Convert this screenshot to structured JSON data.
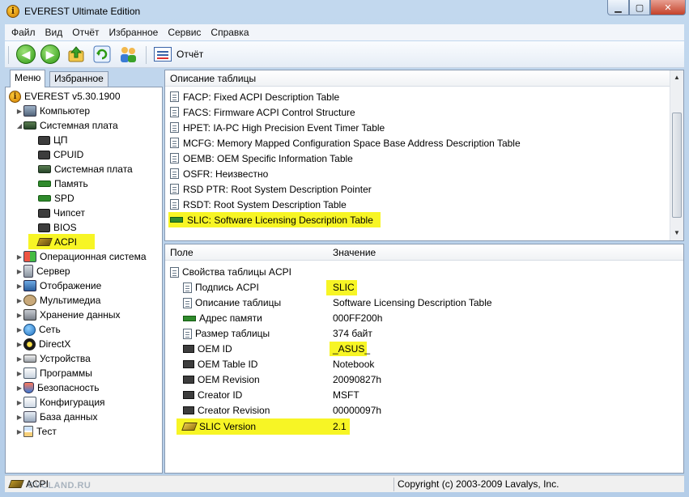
{
  "window": {
    "title": "EVEREST Ultimate Edition"
  },
  "menu": [
    "Файл",
    "Вид",
    "Отчёт",
    "Избранное",
    "Сервис",
    "Справка"
  ],
  "toolbar": {
    "report_label": "Отчёт"
  },
  "left_tabs": {
    "menu": "Меню",
    "favorites": "Избранное"
  },
  "tree": [
    {
      "label": "EVEREST v5.30.1900",
      "icon": "info-icon",
      "level": 0,
      "arrow": ""
    },
    {
      "label": "Компьютер",
      "icon": "computer-icon",
      "level": 1,
      "arrow": "▶"
    },
    {
      "label": "Системная плата",
      "icon": "motherboard-icon",
      "level": 1,
      "arrow": "◢"
    },
    {
      "label": "ЦП",
      "icon": "cpu-icon",
      "level": 2,
      "arrow": ""
    },
    {
      "label": "CPUID",
      "icon": "chip-icon",
      "level": 2,
      "arrow": ""
    },
    {
      "label": "Системная плата",
      "icon": "motherboard-icon",
      "level": 2,
      "arrow": ""
    },
    {
      "label": "Память",
      "icon": "memory-icon",
      "level": 2,
      "arrow": ""
    },
    {
      "label": "SPD",
      "icon": "memory-icon",
      "level": 2,
      "arrow": ""
    },
    {
      "label": "Чипсет",
      "icon": "chip-icon",
      "level": 2,
      "arrow": ""
    },
    {
      "label": "BIOS",
      "icon": "chip-icon",
      "level": 2,
      "arrow": ""
    },
    {
      "label": "ACPI",
      "icon": "acpi-icon",
      "level": 2,
      "arrow": "",
      "highlighted": true
    },
    {
      "label": "Операционная система",
      "icon": "windows-icon",
      "level": 1,
      "arrow": "▶"
    },
    {
      "label": "Сервер",
      "icon": "server-icon",
      "level": 1,
      "arrow": "▶"
    },
    {
      "label": "Отображение",
      "icon": "monitor-icon",
      "level": 1,
      "arrow": "▶"
    },
    {
      "label": "Мультимедиа",
      "icon": "multimedia-icon",
      "level": 1,
      "arrow": "▶"
    },
    {
      "label": "Хранение данных",
      "icon": "storage-icon",
      "level": 1,
      "arrow": "▶"
    },
    {
      "label": "Сеть",
      "icon": "network-icon",
      "level": 1,
      "arrow": "▶"
    },
    {
      "label": "DirectX",
      "icon": "directx-icon",
      "level": 1,
      "arrow": "▶"
    },
    {
      "label": "Устройства",
      "icon": "devices-icon",
      "level": 1,
      "arrow": "▶"
    },
    {
      "label": "Программы",
      "icon": "programs-icon",
      "level": 1,
      "arrow": "▶"
    },
    {
      "label": "Безопасность",
      "icon": "security-icon",
      "level": 1,
      "arrow": "▶"
    },
    {
      "label": "Конфигурация",
      "icon": "configuration-icon",
      "level": 1,
      "arrow": "▶"
    },
    {
      "label": "База данных",
      "icon": "database-icon",
      "level": 1,
      "arrow": "▶"
    },
    {
      "label": "Тест",
      "icon": "hourglass-icon",
      "level": 1,
      "arrow": "▶"
    }
  ],
  "tables_panel": {
    "header": "Описание таблицы",
    "items": [
      {
        "label": "FACP: Fixed ACPI Description Table",
        "icon": "document-icon"
      },
      {
        "label": "FACS: Firmware ACPI Control Structure",
        "icon": "document-icon"
      },
      {
        "label": "HPET: IA-PC High Precision Event Timer Table",
        "icon": "document-icon"
      },
      {
        "label": "MCFG: Memory Mapped Configuration Space Base Address Description Table",
        "icon": "document-icon"
      },
      {
        "label": "OEMB: OEM Specific Information Table",
        "icon": "document-icon"
      },
      {
        "label": "OSFR: Неизвестно",
        "icon": "document-icon"
      },
      {
        "label": "RSD PTR: Root System Description Pointer",
        "icon": "document-icon"
      },
      {
        "label": "RSDT: Root System Description Table",
        "icon": "document-icon"
      },
      {
        "label": "SLIC: Software Licensing Description Table",
        "icon": "memory-icon",
        "highlighted": true
      }
    ]
  },
  "props_panel": {
    "col_field": "Поле",
    "col_value": "Значение",
    "group": "Свойства таблицы ACPI",
    "rows": [
      {
        "field": "Подпись ACPI",
        "value": "SLIC",
        "icon": "document-icon"
      },
      {
        "field": "Описание таблицы",
        "value": "Software Licensing Description Table",
        "icon": "document-icon"
      },
      {
        "field": "Адрес памяти",
        "value": "000FF200h",
        "icon": "memory-icon"
      },
      {
        "field": "Размер таблицы",
        "value": "374 байт",
        "icon": "document-icon"
      },
      {
        "field": "OEM ID",
        "value": "_ASUS_",
        "icon": "chip-icon"
      },
      {
        "field": "OEM Table ID",
        "value": "Notebook",
        "icon": "chip-icon"
      },
      {
        "field": "OEM Revision",
        "value": "20090827h",
        "icon": "chip-icon"
      },
      {
        "field": "Creator ID",
        "value": "MSFT",
        "icon": "chip-icon"
      },
      {
        "field": "Creator Revision",
        "value": "00000097h",
        "icon": "chip-icon"
      },
      {
        "field": "SLIC Version",
        "value": "2.1",
        "icon": "acpi-icon"
      }
    ]
  },
  "status": {
    "left": "ACPI",
    "right": "Copyright (c) 2003-2009 Lavalys, Inc.",
    "watermark": "OVCLAND.RU"
  },
  "colors": {
    "highlight": "#f7f525",
    "title_bg": "#c2d8ee"
  }
}
